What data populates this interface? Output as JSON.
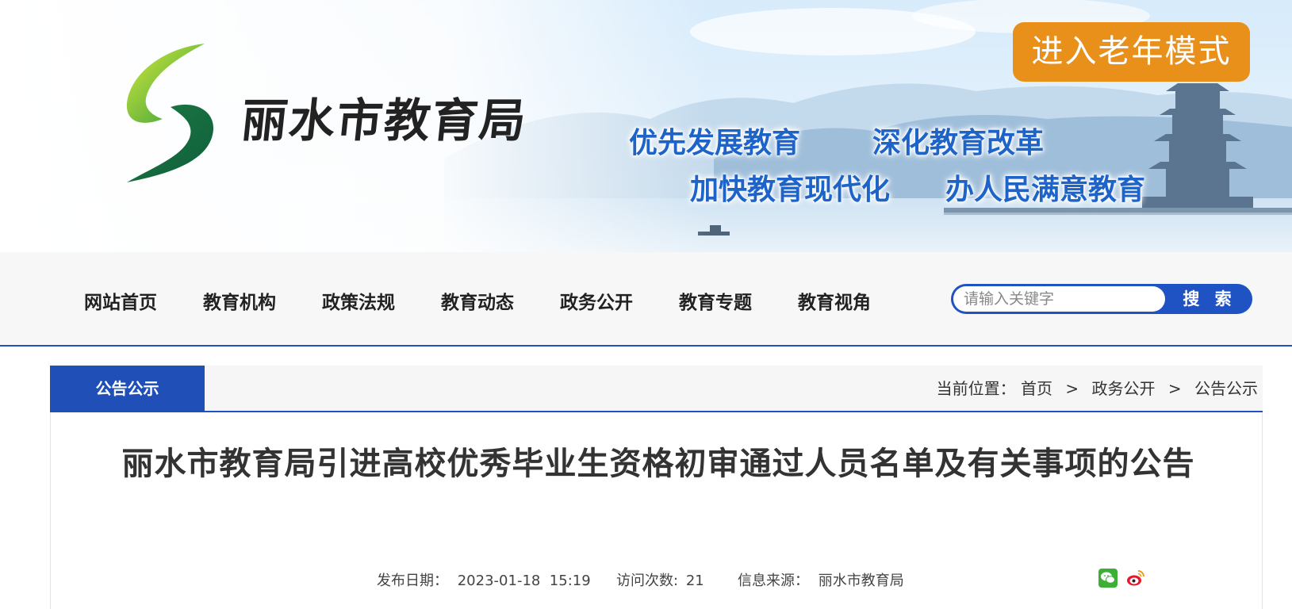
{
  "banner": {
    "site_name": "丽水市教育局",
    "slogans": [
      "优先发展教育",
      "深化教育改革",
      "加快教育现代化",
      "办人民满意教育"
    ],
    "elder_mode_label": "进入老年模式"
  },
  "nav": {
    "items": [
      "网站首页",
      "教育机构",
      "政策法规",
      "教育动态",
      "政务公开",
      "教育专题",
      "教育视角"
    ]
  },
  "search": {
    "placeholder": "请输入关键字",
    "button_label": "搜 索"
  },
  "section": {
    "tab_label": "公告公示"
  },
  "breadcrumb": {
    "prefix": "当前位置：",
    "items": [
      "首页",
      "政务公开",
      "公告公示"
    ],
    "separator": ">"
  },
  "article": {
    "title": "丽水市教育局引进高校优秀毕业生资格初审通过人员名单及有关事项的公告",
    "publish_label": "发布日期：",
    "publish_value": "2023-01-18  15:19",
    "visits_label": "访问次数:",
    "visits_value": "21",
    "source_label": "信息来源：",
    "source_value": "丽水市教育局"
  },
  "share": {
    "icons": [
      "wechat-icon",
      "weibo-icon"
    ]
  },
  "colors": {
    "primary_blue": "#1f53c4",
    "elder_button_orange": "#e8901a",
    "slogan_blue": "#1e63c8"
  }
}
